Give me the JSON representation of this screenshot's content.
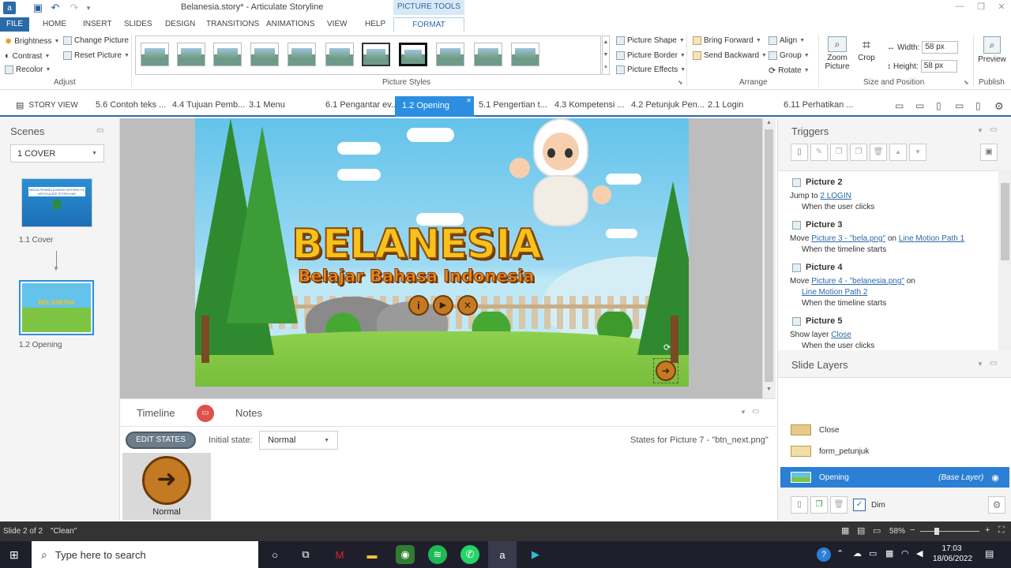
{
  "window": {
    "title": "Belanesia.story* - Articulate Storyline",
    "context_tab": "PICTURE TOOLS",
    "min": "—",
    "max": "❐",
    "close": "✕"
  },
  "ribbon_tabs": [
    "FILE",
    "HOME",
    "INSERT",
    "SLIDES",
    "DESIGN",
    "TRANSITIONS",
    "ANIMATIONS",
    "VIEW",
    "HELP",
    "FORMAT"
  ],
  "adjust": {
    "brightness": "Brightness",
    "contrast": "Contrast",
    "recolor": "Recolor",
    "change_picture": "Change Picture",
    "reset_picture": "Reset Picture",
    "label": "Adjust"
  },
  "picture_styles": {
    "label": "Picture Styles"
  },
  "picture_format": {
    "shape": "Picture Shape",
    "border": "Picture Border",
    "effects": "Picture Effects"
  },
  "arrange": {
    "bring_forward": "Bring Forward",
    "send_backward": "Send Backward",
    "align": "Align",
    "group": "Group",
    "rotate": "Rotate",
    "label": "Arrange"
  },
  "size": {
    "zoom_picture": "Zoom Picture",
    "crop": "Crop",
    "width_label": "Width:",
    "width_value": "58 px",
    "height_label": "Height:",
    "height_value": "58 px",
    "label": "Size and Position"
  },
  "publish": {
    "preview": "Preview",
    "publish": "Publish"
  },
  "slide_tabs": {
    "story_view": "STORY VIEW",
    "tabs": [
      "5.6 Contoh teks ...",
      "4.4 Tujuan Pemb...",
      "3.1 Menu",
      "6.1 Pengantar ev...",
      "1.2 Opening",
      "5.1 Pengertian t...",
      "4.3 Kompetensi ...",
      "4.2 Petunjuk Pen...",
      "2.1 Login",
      "6.11 Perhatikan ..."
    ],
    "close": "✕"
  },
  "scenes": {
    "title": "Scenes",
    "selected_scene": "1 COVER",
    "slides": [
      {
        "label": "1.1 Cover",
        "thumb_text": "MEDIA PEMBELAJARAN INTERAKTIF ARTICULATE STORYLINE"
      },
      {
        "label": "1.2 Opening",
        "thumb_text": "BELANESIA"
      }
    ]
  },
  "slide": {
    "title": "BELANESIA",
    "subtitle": "Belajar Bahasa Indonesia",
    "btn_info": "i",
    "btn_play": "▶",
    "btn_close": "✕",
    "btn_next": "➜"
  },
  "timeline": {
    "tab_timeline": "Timeline",
    "tab_notes": "Notes",
    "edit_states": "EDIT STATES",
    "initial_state_label": "Initial state:",
    "initial_state_value": "Normal",
    "states_info": "States for Picture 7 - \"btn_next.png\"",
    "state_normal": "Normal"
  },
  "triggers": {
    "title": "Triggers",
    "items": [
      {
        "object": "Picture 2",
        "action": "Jump to",
        "target": "2 LOGIN",
        "when": "When the user clicks"
      },
      {
        "object": "Picture 3",
        "action": "Move",
        "target": "Picture 3 - \"bela.png\"",
        "on": "on",
        "path": "Line Motion Path 1",
        "when": "When the timeline starts"
      },
      {
        "object": "Picture 4",
        "action": "Move",
        "target": "Picture 4 - \"belanesia.png\"",
        "on": "on",
        "path": "Line Motion Path 2",
        "when": "When the timeline starts"
      },
      {
        "object": "Picture 5",
        "action": "Show layer",
        "target": "Close",
        "when": "When the user clicks"
      }
    ]
  },
  "layers": {
    "title": "Slide Layers",
    "items": [
      {
        "name": "Close",
        "tag": ""
      },
      {
        "name": "form_petunjuk",
        "tag": ""
      },
      {
        "name": "Opening",
        "tag": "(Base Layer)"
      }
    ],
    "dim": "Dim"
  },
  "status": {
    "slide": "Slide 2 of 2",
    "state": "\"Clean\"",
    "zoom": "58%"
  },
  "taskbar": {
    "search_placeholder": "Type here to search",
    "time": "17:03",
    "date": "18/06/2022"
  },
  "colors": {
    "accent": "#2b6aa8",
    "active_tab": "#2b8ee0",
    "layer_selected": "#2b7fd4",
    "title_yellow": "#f7c21b",
    "subtitle_orange": "#f08a1e"
  }
}
